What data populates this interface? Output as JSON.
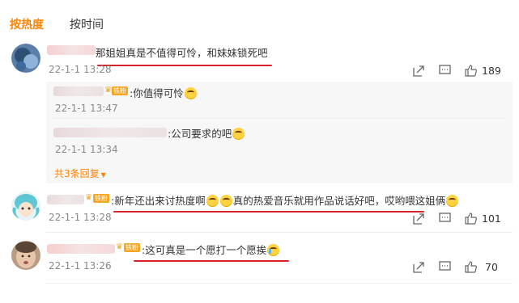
{
  "tabs": [
    {
      "label": "按热度",
      "active": true
    },
    {
      "label": "按时间",
      "active": false
    }
  ],
  "colors": {
    "accent": "#ff8200",
    "underline": "#d6232b",
    "meta": "#8a8a8a"
  },
  "comments": [
    {
      "text": "那姐姐真是不值得可怜，和妹妹锁死吧",
      "time": "22-1-1 13:28",
      "likes": "189",
      "replies": [
        {
          "text": ":你值得可怜",
          "time": "22-1-1 13:47"
        },
        {
          "text": ":公司要求的吧",
          "time": "22-1-1 13:34"
        }
      ],
      "more_replies": "共3条回复"
    },
    {
      "text_a": ":新年还出来讨热度啊",
      "text_b": "真的热爱音乐就用作品说话好吧，哎哟喂这姐俩",
      "time": "22-1-1 13:28",
      "likes": "101"
    },
    {
      "text": ":这可真是一个愿打一个愿挨",
      "time": "22-1-1 13:26",
      "likes": "70"
    }
  ],
  "icons": [
    "share-icon",
    "comment-icon",
    "like-icon",
    "crown-icon",
    "fan-badge-icon",
    "emoji-icon",
    "chevron-down-icon"
  ]
}
